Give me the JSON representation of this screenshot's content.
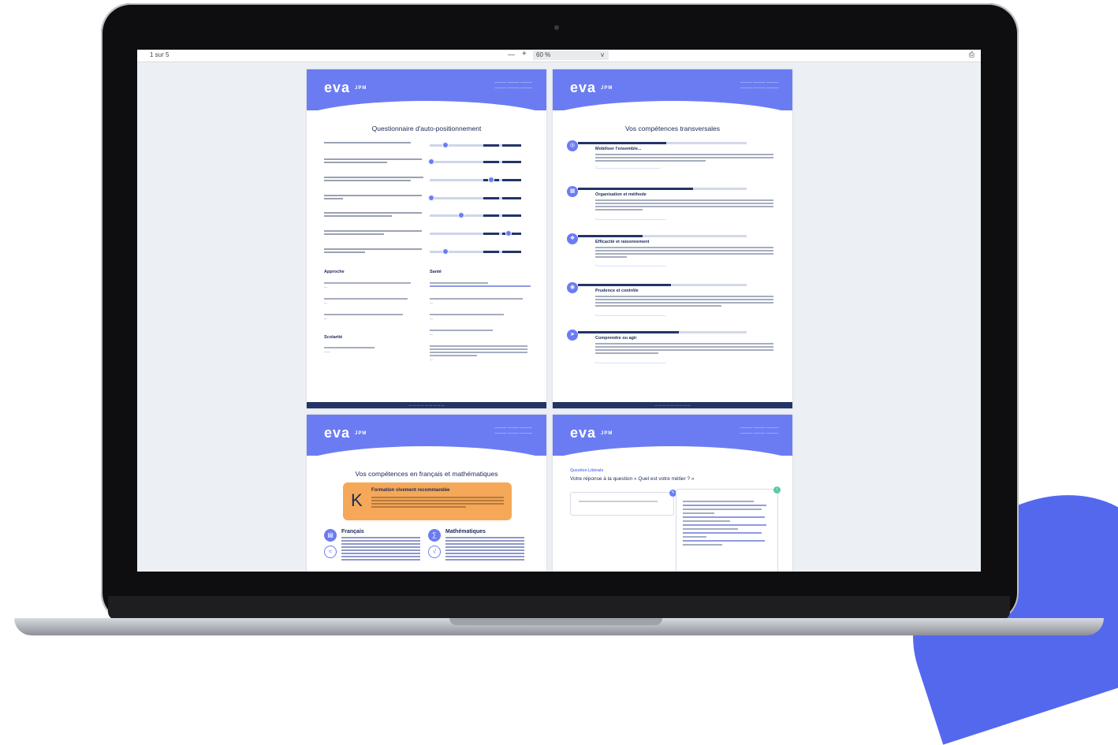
{
  "toolbar": {
    "page_indicator": "1 sur 5",
    "zoom_out": "—",
    "zoom_in": "+",
    "zoom": "60 %",
    "dropdown_chevron": "v",
    "print_icon": "printer-icon"
  },
  "brand": {
    "logo": "eva",
    "suffix": "JPM",
    "accent": "#6b7cf3",
    "navy": "#223566",
    "orange": "#f5a857"
  },
  "page1": {
    "title": "Questionnaire d'auto-positionnement",
    "sliders": [
      0.17,
      0.02,
      0.68,
      0.02,
      0.33,
      0.86,
      0.17
    ],
    "left_sections": [
      "Approche",
      "Scolarité"
    ],
    "right_section": "Santé"
  },
  "page2": {
    "title": "Vos compétences transversales",
    "competences": [
      {
        "title": "Mobiliser l'ensemble...",
        "level": 0.52
      },
      {
        "title": "Organisation et méthode",
        "level": 0.68
      },
      {
        "title": "Efficacité et raisonnement",
        "level": 0.38
      },
      {
        "title": "Prudence et contrôle",
        "level": 0.55
      },
      {
        "title": "Comprendre ou agir",
        "level": 0.6
      }
    ]
  },
  "page3": {
    "title": "Vos compétences en français et mathématiques",
    "banner_title": "Formation vivement recommandée",
    "subjects": [
      "Français",
      "Mathématiques"
    ]
  },
  "page4": {
    "section": "Question Libérale",
    "subtitle": "Votre réponse à la question « Quel est votre métier ? »"
  }
}
